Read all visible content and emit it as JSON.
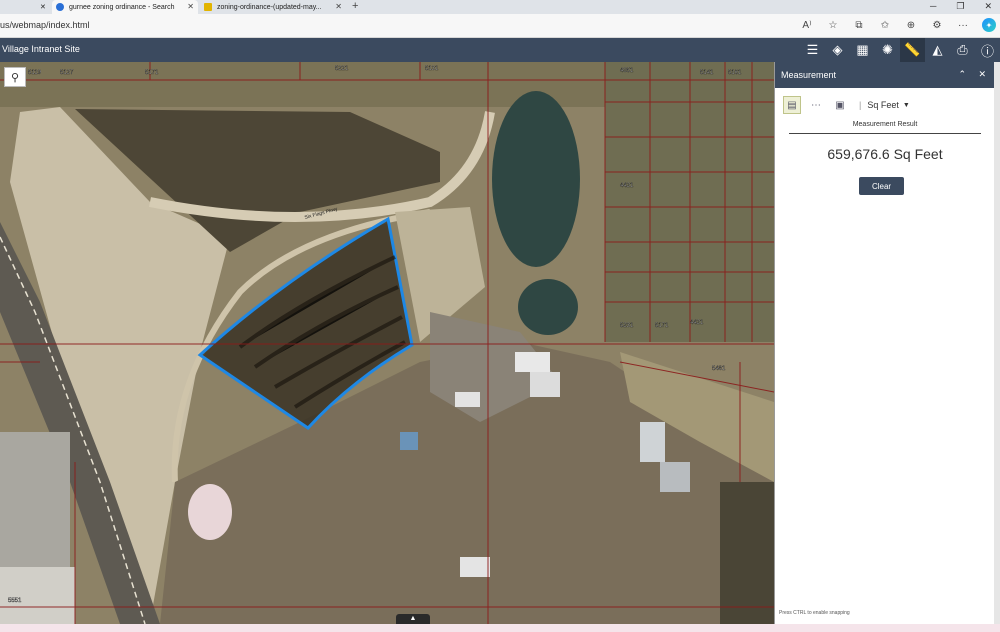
{
  "browser": {
    "tabs": [
      {
        "title": "gurnee zoning ordinance - Search",
        "close": "✕"
      },
      {
        "title": "zoning-ordinance-(updated-may...",
        "close": "✕"
      }
    ],
    "first_tab_close": "✕",
    "new_tab": "+",
    "window_controls": [
      "─",
      "❐",
      "✕"
    ],
    "url": "us/webmap/index.html",
    "toolbar_icons": [
      "A⁾",
      "☆",
      "⧉",
      "✩",
      "⊕",
      "⚙",
      "···",
      "✦"
    ]
  },
  "app": {
    "title": "Village Intranet Site",
    "tools": [
      {
        "name": "layer-list",
        "glyph": "☰"
      },
      {
        "name": "layers",
        "glyph": "◈"
      },
      {
        "name": "basemap-gallery",
        "glyph": "▦"
      },
      {
        "name": "legend",
        "glyph": "✺"
      },
      {
        "name": "measurement",
        "glyph": "📏"
      },
      {
        "name": "print-preview",
        "glyph": "◭"
      },
      {
        "name": "print",
        "glyph": "⎙"
      },
      {
        "name": "about",
        "glyph": "ⓘ"
      }
    ]
  },
  "map": {
    "search_glyph": "⚲",
    "bottom_handle_glyph": "▲",
    "road_label": "Six Flags Pkwy",
    "parcel_labels": [
      "5119",
      "5127",
      "5171",
      "5221",
      "5131",
      "4051",
      "5141",
      "5161",
      "4421",
      "5231",
      "5171",
      "4421",
      "5481",
      "5551"
    ]
  },
  "panel": {
    "title": "Measurement",
    "collapse_glyph": "⌃",
    "close_glyph": "✕",
    "tool_glyphs": [
      "▤",
      "⋯",
      "▣"
    ],
    "unit_separator": "|",
    "unit": "Sq Feet",
    "unit_caret": "▼",
    "result_label": "Measurement Result",
    "result_value": "659,676.6 Sq Feet",
    "clear_label": "Clear",
    "snap_hint": "Press CTRL to enable snapping"
  },
  "colors": {
    "header_bg": "#3b4a5f",
    "measurement_outline": "#1e88e5",
    "parcel_lines": "#8b1a1a"
  }
}
